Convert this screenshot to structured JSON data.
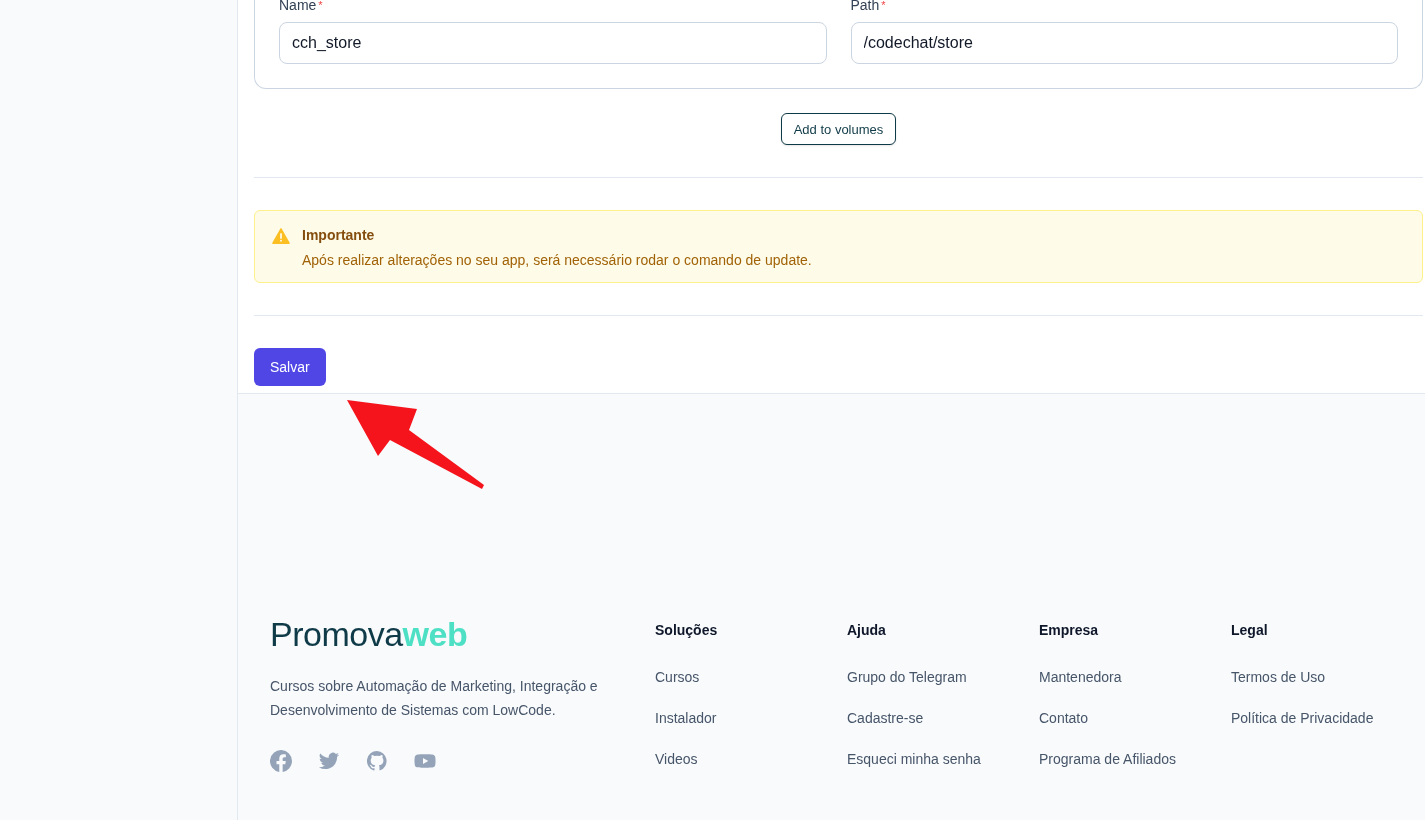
{
  "volume_form": {
    "fields": [
      {
        "label": "Name",
        "required_mark": "*",
        "value": "cch_store"
      },
      {
        "label": "Path",
        "required_mark": "*",
        "value": "/codechat/store"
      }
    ],
    "add_button": "Add to volumes"
  },
  "alert": {
    "title": "Importante",
    "message": "Após realizar alterações no seu app, será necessário rodar o comando de update."
  },
  "save_button": "Salvar",
  "footer": {
    "logo": "Promova**web**",
    "tagline": "Cursos sobre Automação de Marketing, Integração e Desenvolvimento de Sistemas com LowCode.",
    "social": [
      {
        "kind": "facebook"
      },
      {
        "kind": "twitter"
      },
      {
        "kind": "github"
      },
      {
        "kind": "youtube"
      }
    ],
    "columns": [
      {
        "heading": "Soluções",
        "links": [
          "Cursos",
          "Instalador",
          "Videos"
        ]
      },
      {
        "heading": "Ajuda",
        "links": [
          "Grupo do Telegram",
          "Cadastre-se",
          "Esqueci minha senha"
        ]
      },
      {
        "heading": "Empresa",
        "links": [
          "Mantenedora",
          "Contato",
          "Programa de Afiliados"
        ]
      },
      {
        "heading": "Legal",
        "links": [
          "Termos de Uso",
          "Política de Privacidade"
        ]
      }
    ]
  }
}
